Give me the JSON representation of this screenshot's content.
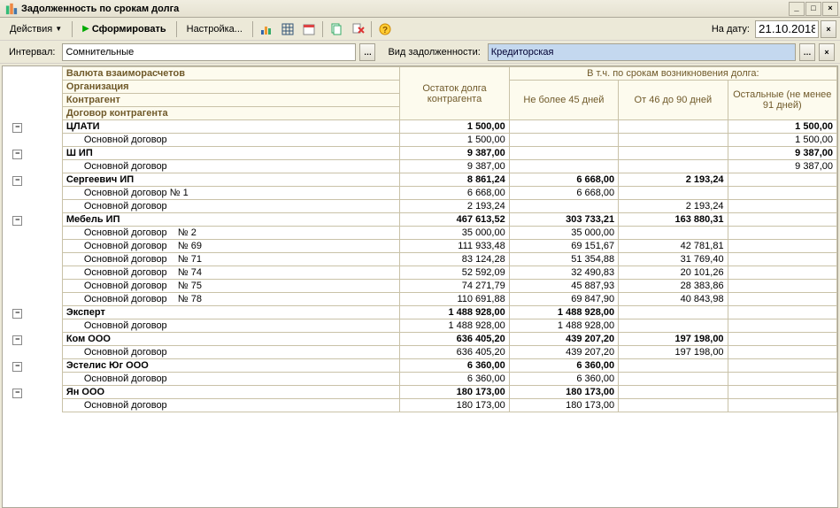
{
  "window": {
    "title": "Задолженность по срокам долга"
  },
  "toolbar": {
    "actions": "Действия",
    "form": "Сформировать",
    "settings": "Настройка...",
    "date_label": "На дату:",
    "date_value": "21.10.2018"
  },
  "filters": {
    "interval_label": "Интервал:",
    "interval_value": "Сомнительные",
    "debt_type_label": "Вид задолженности:",
    "debt_type_value": "Кредиторская"
  },
  "headers": {
    "h1": "Валюта взаиморасчетов",
    "h2": "Организация",
    "h3": "Контрагент",
    "h4": "Договор контрагента",
    "balance": "Остаток долга контрагента",
    "by_period": "В т.ч. по срокам возникновения долга:",
    "p1": "Не более 45 дней",
    "p2": "От 46 до 90 дней",
    "p3": "Остальные (не менее 91 дней)"
  },
  "rows": [
    {
      "t": "g",
      "exp": "-",
      "name": "ЦЛАТИ",
      "bal": "1 500,00",
      "c1": "",
      "c2": "",
      "c3": "1 500,00"
    },
    {
      "t": "d",
      "name": "Основной договор",
      "bal": "1 500,00",
      "c1": "",
      "c2": "",
      "c3": "1 500,00"
    },
    {
      "t": "g",
      "exp": "-",
      "name": "Ш ИП",
      "bal": "9 387,00",
      "c1": "",
      "c2": "",
      "c3": "9 387,00"
    },
    {
      "t": "d",
      "name": "Основной договор",
      "bal": "9 387,00",
      "c1": "",
      "c2": "",
      "c3": "9 387,00"
    },
    {
      "t": "g",
      "exp": "-",
      "name": "Сергеевич ИП",
      "bal": "8 861,24",
      "c1": "6 668,00",
      "c2": "2 193,24",
      "c3": ""
    },
    {
      "t": "d",
      "name": "Основной договор № 1",
      "bal": "6 668,00",
      "c1": "6 668,00",
      "c2": "",
      "c3": ""
    },
    {
      "t": "d",
      "name": "Основной договор",
      "bal": "2 193,24",
      "c1": "",
      "c2": "2 193,24",
      "c3": ""
    },
    {
      "t": "g",
      "exp": "-",
      "name": "Мебель ИП",
      "bal": "467 613,52",
      "c1": "303 733,21",
      "c2": "163 880,31",
      "c3": ""
    },
    {
      "t": "d",
      "name": "Основной договор    № 2",
      "bal": "35 000,00",
      "c1": "35 000,00",
      "c2": "",
      "c3": ""
    },
    {
      "t": "d",
      "name": "Основной договор    № 69",
      "bal": "111 933,48",
      "c1": "69 151,67",
      "c2": "42 781,81",
      "c3": ""
    },
    {
      "t": "d",
      "name": "Основной договор    № 71",
      "bal": "83 124,28",
      "c1": "51 354,88",
      "c2": "31 769,40",
      "c3": ""
    },
    {
      "t": "d",
      "name": "Основной договор    № 74",
      "bal": "52 592,09",
      "c1": "32 490,83",
      "c2": "20 101,26",
      "c3": ""
    },
    {
      "t": "d",
      "name": "Основной договор    № 75",
      "bal": "74 271,79",
      "c1": "45 887,93",
      "c2": "28 383,86",
      "c3": ""
    },
    {
      "t": "d",
      "name": "Основной договор    № 78",
      "bal": "110 691,88",
      "c1": "69 847,90",
      "c2": "40 843,98",
      "c3": ""
    },
    {
      "t": "g",
      "exp": "-",
      "name": "Эксперт",
      "bal": "1 488 928,00",
      "c1": "1 488 928,00",
      "c2": "",
      "c3": ""
    },
    {
      "t": "d",
      "name": "Основной договор",
      "bal": "1 488 928,00",
      "c1": "1 488 928,00",
      "c2": "",
      "c3": ""
    },
    {
      "t": "g",
      "exp": "-",
      "name": "Ком ООО",
      "bal": "636 405,20",
      "c1": "439 207,20",
      "c2": "197 198,00",
      "c3": ""
    },
    {
      "t": "d",
      "name": "Основной договор",
      "bal": "636 405,20",
      "c1": "439 207,20",
      "c2": "197 198,00",
      "c3": ""
    },
    {
      "t": "g",
      "exp": "-",
      "name": "Эстелис Юг ООО",
      "bal": "6 360,00",
      "c1": "6 360,00",
      "c2": "",
      "c3": ""
    },
    {
      "t": "d",
      "name": "Основной договор",
      "bal": "6 360,00",
      "c1": "6 360,00",
      "c2": "",
      "c3": ""
    },
    {
      "t": "g",
      "exp": "-",
      "name": "Ян ООО",
      "bal": "180 173,00",
      "c1": "180 173,00",
      "c2": "",
      "c3": ""
    },
    {
      "t": "d",
      "name": "Основной договор",
      "bal": "180 173,00",
      "c1": "180 173,00",
      "c2": "",
      "c3": ""
    }
  ]
}
